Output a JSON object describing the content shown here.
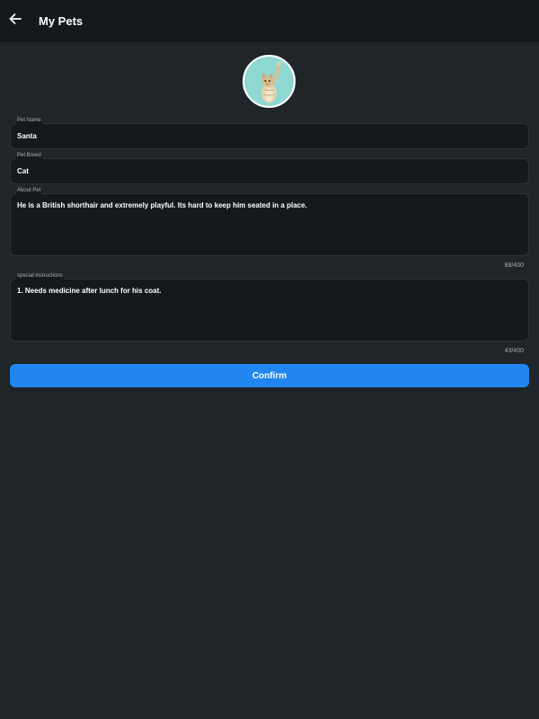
{
  "header": {
    "title": "My Pets",
    "back_icon": "arrow-left-icon"
  },
  "avatar": {
    "icon": "pet-photo-cat"
  },
  "form": {
    "pet_name": {
      "label": "Pet Name",
      "value": "Santa"
    },
    "pet_breed": {
      "label": "Pet Breed",
      "value": "Cat"
    },
    "about_pet": {
      "label": "About Pet",
      "value": "He is a British shorthair and extremely playful. Its hard to keep him seated in a place.",
      "counter": "88/400"
    },
    "special_instructions": {
      "label": "special instructions",
      "value": "1. Needs medicine after lunch for his coat.",
      "counter": "43/400"
    }
  },
  "confirm_button": {
    "label": "Confirm"
  },
  "colors": {
    "background": "#1f2529",
    "surface": "#15191c",
    "accent": "#2186ef"
  }
}
